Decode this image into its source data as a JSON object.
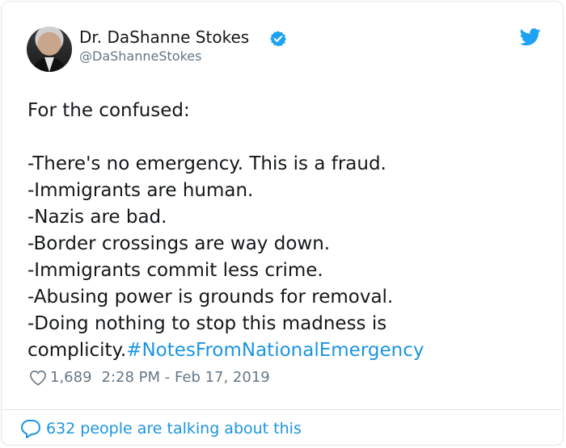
{
  "author": {
    "display_name": "Dr. DaShanne Stokes",
    "handle": "@DaShanneStokes",
    "avatar_icon": "profile-photo",
    "verified_icon": "verified-badge-icon"
  },
  "brand_icon": "twitter-bird-icon",
  "tweet": {
    "lines": [
      "For the confused:",
      "",
      "-There's no emergency. This is a fraud.",
      "-Immigrants are human.",
      "-Nazis are bad.",
      "-Border crossings are way down.",
      "-Immigrants commit less crime.",
      "-Abusing power is grounds for removal.",
      "-Doing nothing to stop this madness is"
    ],
    "last_line_text": "complicity.",
    "hashtag": "#NotesFromNationalEmergency"
  },
  "meta": {
    "likes": "1,689",
    "timestamp": "2:28 PM - Feb 17, 2019"
  },
  "footer": {
    "talking_text": "632 people are talking about this"
  },
  "colors": {
    "link": "#1b95e0",
    "muted": "#657786",
    "text": "#14171a",
    "border": "#e1e8ed"
  }
}
